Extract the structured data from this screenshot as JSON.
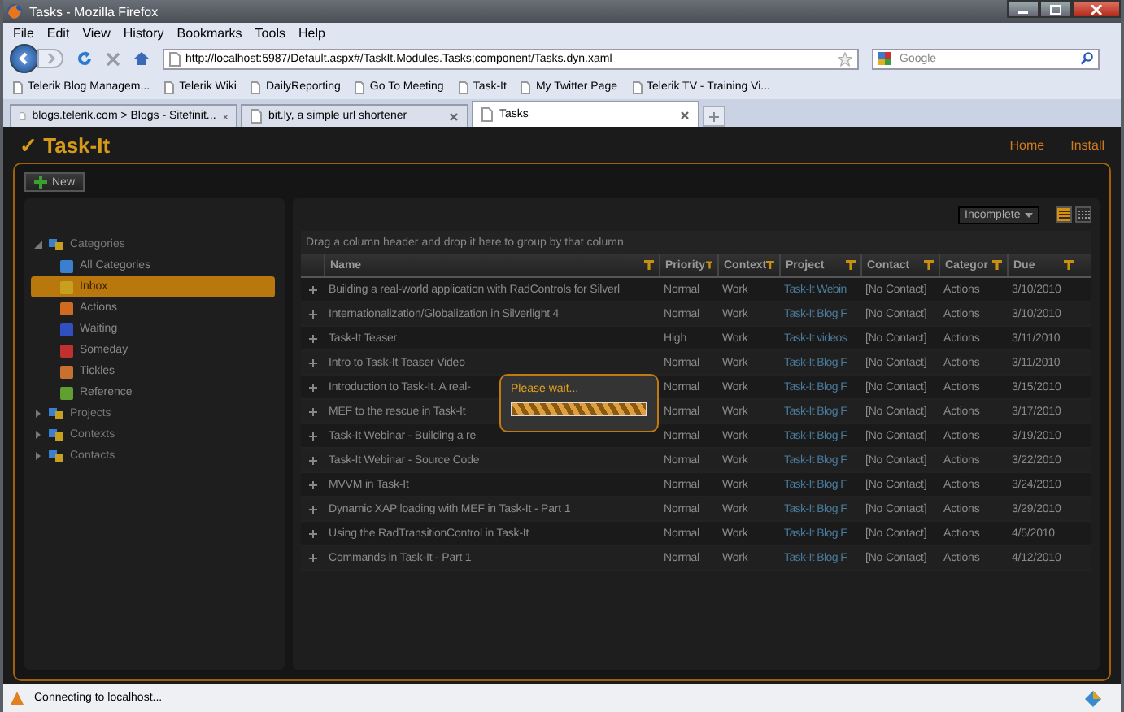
{
  "browser": {
    "title": "Tasks - Mozilla Firefox",
    "menu": [
      "File",
      "Edit",
      "View",
      "History",
      "Bookmarks",
      "Tools",
      "Help"
    ],
    "url": "http://localhost:5987/Default.aspx#/TaskIt.Modules.Tasks;component/Tasks.dyn.xaml",
    "search_placeholder": "Google",
    "bookmarks": [
      "Telerik Blog Managem...",
      "Telerik Wiki",
      "DailyReporting",
      "Go To Meeting",
      "Task-It",
      "My Twitter Page",
      "Telerik TV - Training Vi..."
    ],
    "tabs": [
      {
        "label": "blogs.telerik.com > Blogs - Sitefinit...",
        "selected": false
      },
      {
        "label": "bit.ly, a simple url shortener",
        "selected": false
      },
      {
        "label": "Tasks",
        "selected": true
      }
    ]
  },
  "app": {
    "title": "✓ Task-It",
    "nav": [
      "Home",
      "Install"
    ],
    "new_button": "New",
    "sidebar": [
      {
        "label": "Categories",
        "expanded": true,
        "selected": false,
        "children": [
          {
            "label": "All Categories",
            "selected": false
          },
          {
            "label": "Inbox",
            "selected": true
          },
          {
            "label": "Actions",
            "selected": false
          },
          {
            "label": "Waiting",
            "selected": false
          },
          {
            "label": "Someday",
            "selected": false
          },
          {
            "label": "Tickles",
            "selected": false
          },
          {
            "label": "Reference",
            "selected": false
          }
        ]
      },
      {
        "label": "Projects",
        "expanded": false,
        "selected": false
      },
      {
        "label": "Contexts",
        "expanded": false,
        "selected": false
      },
      {
        "label": "Contacts",
        "expanded": false,
        "selected": false
      }
    ],
    "filter": "Incomplete",
    "view_toggle": [
      {
        "selected": true
      },
      {
        "selected": false
      }
    ],
    "group_hint": "Drag a column header and drop it here to group by that column",
    "columns": [
      "Name",
      "Priority",
      "Context",
      "Project",
      "Contact",
      "Categor",
      "Due"
    ],
    "rows": [
      {
        "name": "Building a real-world application with RadControls for Silverl",
        "priority": "Normal",
        "context": "Work",
        "project": "Task-It Webin",
        "contact": "[No Contact]",
        "category": "Actions",
        "due": "3/10/2010"
      },
      {
        "name": "Internationalization/Globalization in Silverlight 4",
        "priority": "Normal",
        "context": "Work",
        "project": "Task-It Blog F",
        "contact": "[No Contact]",
        "category": "Actions",
        "due": "3/10/2010"
      },
      {
        "name": "Task-It Teaser",
        "priority": "High",
        "context": "Work",
        "project": "Task-It videos",
        "contact": "[No Contact]",
        "category": "Actions",
        "due": "3/11/2010"
      },
      {
        "name": "Intro to Task-It Teaser Video",
        "priority": "Normal",
        "context": "Work",
        "project": "Task-It Blog F",
        "contact": "[No Contact]",
        "category": "Actions",
        "due": "3/11/2010"
      },
      {
        "name": "Introduction to Task-It. A real-",
        "priority": "Normal",
        "context": "Work",
        "project": "Task-It Blog F",
        "contact": "[No Contact]",
        "category": "Actions",
        "due": "3/15/2010"
      },
      {
        "name": "MEF to the rescue in Task-It",
        "priority": "Normal",
        "context": "Work",
        "project": "Task-It Blog F",
        "contact": "[No Contact]",
        "category": "Actions",
        "due": "3/17/2010"
      },
      {
        "name": "Task-It Webinar - Building a re",
        "priority": "Normal",
        "context": "Work",
        "project": "Task-It Blog F",
        "contact": "[No Contact]",
        "category": "Actions",
        "due": "3/19/2010"
      },
      {
        "name": "Task-It Webinar - Source Code",
        "priority": "Normal",
        "context": "Work",
        "project": "Task-It Blog F",
        "contact": "[No Contact]",
        "category": "Actions",
        "due": "3/22/2010"
      },
      {
        "name": "MVVM in Task-It",
        "priority": "Normal",
        "context": "Work",
        "project": "Task-It Blog F",
        "contact": "[No Contact]",
        "category": "Actions",
        "due": "3/24/2010"
      },
      {
        "name": "Dynamic XAP loading with MEF in Task-It - Part 1",
        "priority": "Normal",
        "context": "Work",
        "project": "Task-It Blog F",
        "contact": "[No Contact]",
        "category": "Actions",
        "due": "3/29/2010"
      },
      {
        "name": "Using the RadTransitionControl in Task-It",
        "priority": "Normal",
        "context": "Work",
        "project": "Task-It Blog F",
        "contact": "[No Contact]",
        "category": "Actions",
        "due": "4/5/2010"
      },
      {
        "name": "Commands in Task-It - Part 1",
        "priority": "Normal",
        "context": "Work",
        "project": "Task-It Blog F",
        "contact": "[No Contact]",
        "category": "Actions",
        "due": "4/12/2010"
      }
    ],
    "loading": {
      "text": "Please wait...",
      "level": 1
    }
  },
  "status_bar": "Connecting to localhost..."
}
